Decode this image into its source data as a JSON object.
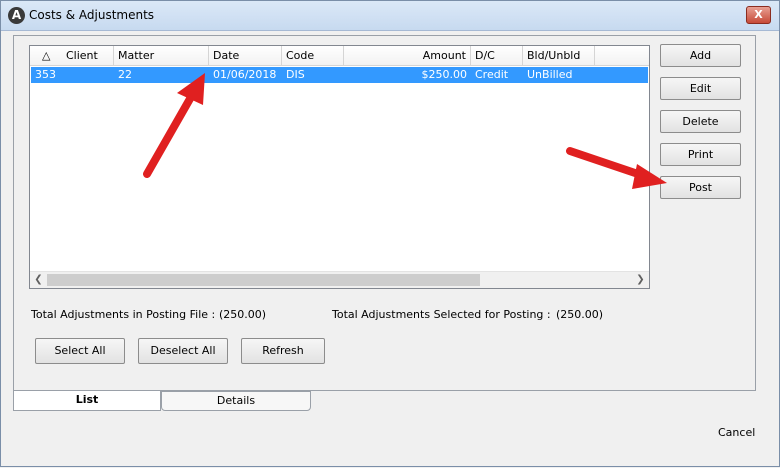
{
  "window": {
    "title": "Costs & Adjustments",
    "close_glyph": "X"
  },
  "grid": {
    "columns": [
      {
        "label": "Client"
      },
      {
        "label": "Matter"
      },
      {
        "label": "Date"
      },
      {
        "label": "Code"
      },
      {
        "label": "Amount"
      },
      {
        "label": "D/C"
      },
      {
        "label": "Bld/Unbld"
      }
    ],
    "rows": [
      {
        "client": "353",
        "matter": "22",
        "date": "01/06/2018",
        "code": "DIS",
        "amount": "$250.00",
        "dc": "Credit",
        "bld": "UnBilled"
      }
    ]
  },
  "side_buttons": {
    "add": "Add",
    "edit": "Edit",
    "delete": "Delete",
    "print": "Print",
    "post": "Post"
  },
  "totals": {
    "posting_file_label": "Total Adjustments in Posting File :",
    "posting_file_value": "(250.00)",
    "selected_label": "Total Adjustments Selected for Posting :",
    "selected_value": "(250.00)"
  },
  "bottom_buttons": {
    "select_all": "Select All",
    "deselect_all": "Deselect All",
    "refresh": "Refresh"
  },
  "tabs": {
    "list": "List",
    "details": "Details"
  },
  "cancel": "Cancel",
  "colors": {
    "selection": "#3399ff",
    "annotation_arrow": "#e02020"
  }
}
